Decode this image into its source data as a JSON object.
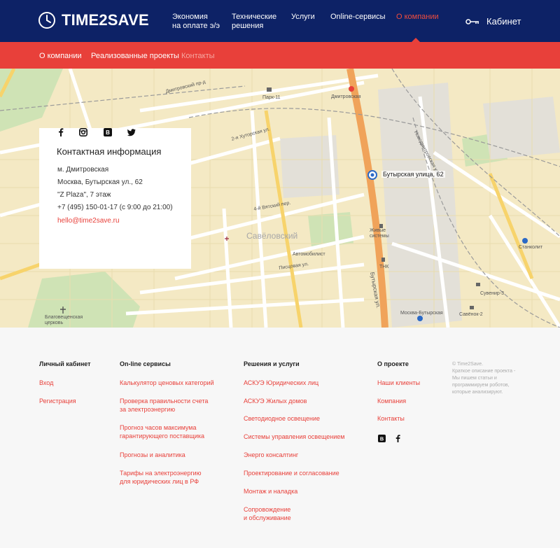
{
  "brand": {
    "name": "TIME2SAVE"
  },
  "nav": {
    "items": [
      {
        "label_1": "Экономия",
        "label_2": "на оплате э/э"
      },
      {
        "label_1": "Технические",
        "label_2": "решения"
      },
      {
        "label_1": "Услуги"
      },
      {
        "label_1": "Online-сервисы"
      },
      {
        "label_1": "О компании"
      }
    ],
    "cabinet_label": "Кабинет"
  },
  "subnav": {
    "items": [
      "О компании",
      "Реализованные проекты",
      "Контакты"
    ]
  },
  "map": {
    "pin_label": "Бутырская улица, 62",
    "labels": {
      "district": "Савёловский",
      "street_1": "Бутырская ул.",
      "street_2": "Дмитровский пр-д",
      "street_3": "2-я Хуторская ул.",
      "street_4": "4-й Вятский пер.",
      "street_5": "Писцовая ул.",
      "street_6": "Новодмитровская ул.",
      "poi_1": "Автомобилист",
      "poi_2": "Дмитровская",
      "poi_3": "Стан­колит",
      "poi_4": "Москва-Бутырская",
      "poi_5": "Живые системы",
      "poi_6": "Парк-11",
      "poi_7": "Благовещенская церковь",
      "poi_8": "ТНК",
      "poi_9": "Сувенир-3",
      "poi_10": "Савёнок-2"
    }
  },
  "contact": {
    "title": "Контактная информация",
    "lines": [
      "м. Дмитровская",
      "Москва, Бутырская ул., 62",
      "\"Z Plaza\", 7 этаж",
      "+7 (495) 150-01-17 (с 9:00 до 21:00)"
    ],
    "email": "hello@time2save.ru"
  },
  "footer": {
    "cols": [
      {
        "title": "Личный кабинет",
        "links": [
          "Вход",
          "Регистрация"
        ]
      },
      {
        "title": "On-line сервисы",
        "links": [
          [
            "Калькулятор ценовых категорий"
          ],
          [
            "Проверка правильности счета",
            "за электроэнергию"
          ],
          [
            "Прогноз часов максимума",
            "гарантирующего поставщика"
          ],
          [
            "Прогнозы и аналитика"
          ],
          [
            "Тарифы на электроэнергию",
            "для юридических лиц в РФ"
          ]
        ]
      },
      {
        "title": "Решения и услуги",
        "links": [
          "АСКУЭ Юридических лиц",
          "АСКУЭ Жилых домов",
          "Светодиодное освещение",
          "Системы управления освещением",
          "Энерго консалтинг",
          "Проектирование и согласование",
          "Монтаж и наладка",
          [
            "Сопровождение",
            "и обслуживание"
          ]
        ]
      },
      {
        "title": "О проекте",
        "links": [
          "Наши клиенты",
          "Компания",
          "Контакты"
        ]
      }
    ],
    "note_lines": [
      "© Time2Save.",
      "Краткое описание проекта -",
      "Мы пишем статьи и",
      "программируем роботов,",
      "которые анализируют."
    ]
  }
}
